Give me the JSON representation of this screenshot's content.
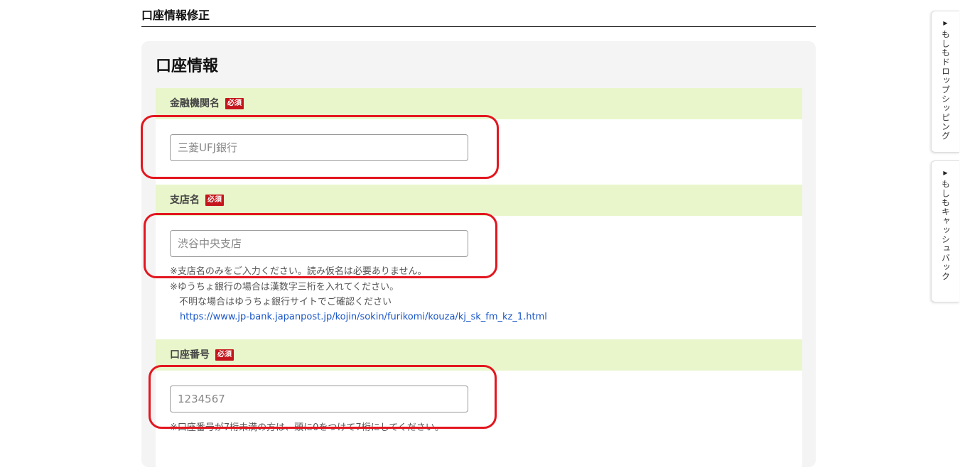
{
  "page": {
    "title": "口座情報修正"
  },
  "panel": {
    "title": "口座情報"
  },
  "required_badge": "必須",
  "bank": {
    "label": "金融機関名",
    "placeholder": "三菱UFJ銀行",
    "value": ""
  },
  "branch": {
    "label": "支店名",
    "placeholder": "渋谷中央支店",
    "value": "",
    "notes": [
      "※支店名のみをご入力ください。読み仮名は必要ありません。",
      "※ゆうちょ銀行の場合は漢数字三桁を入れてください。",
      "　不明な場合はゆうちょ銀行サイトでご確認ください"
    ],
    "link": "https://www.jp-bank.japanpost.jp/kojin/sokin/furikomi/kouza/kj_sk_fm_kz_1.html"
  },
  "account": {
    "label": "口座番号",
    "placeholder": "1234567",
    "value": "",
    "note": "※口座番号が7桁未満の方は、頭に0をつけて7桁にしてください。"
  },
  "side_tabs": [
    {
      "label": "もしもドロップシッピング",
      "arrow": "▶"
    },
    {
      "label": "もしもキャッシュバック",
      "arrow": "▶"
    }
  ],
  "colors": {
    "section_header_bg": "#e9f6cb",
    "panel_bg": "#f4f4f4",
    "required_badge": "#c4161c",
    "highlight_ring": "#e3161f",
    "link": "#1a56c8"
  }
}
